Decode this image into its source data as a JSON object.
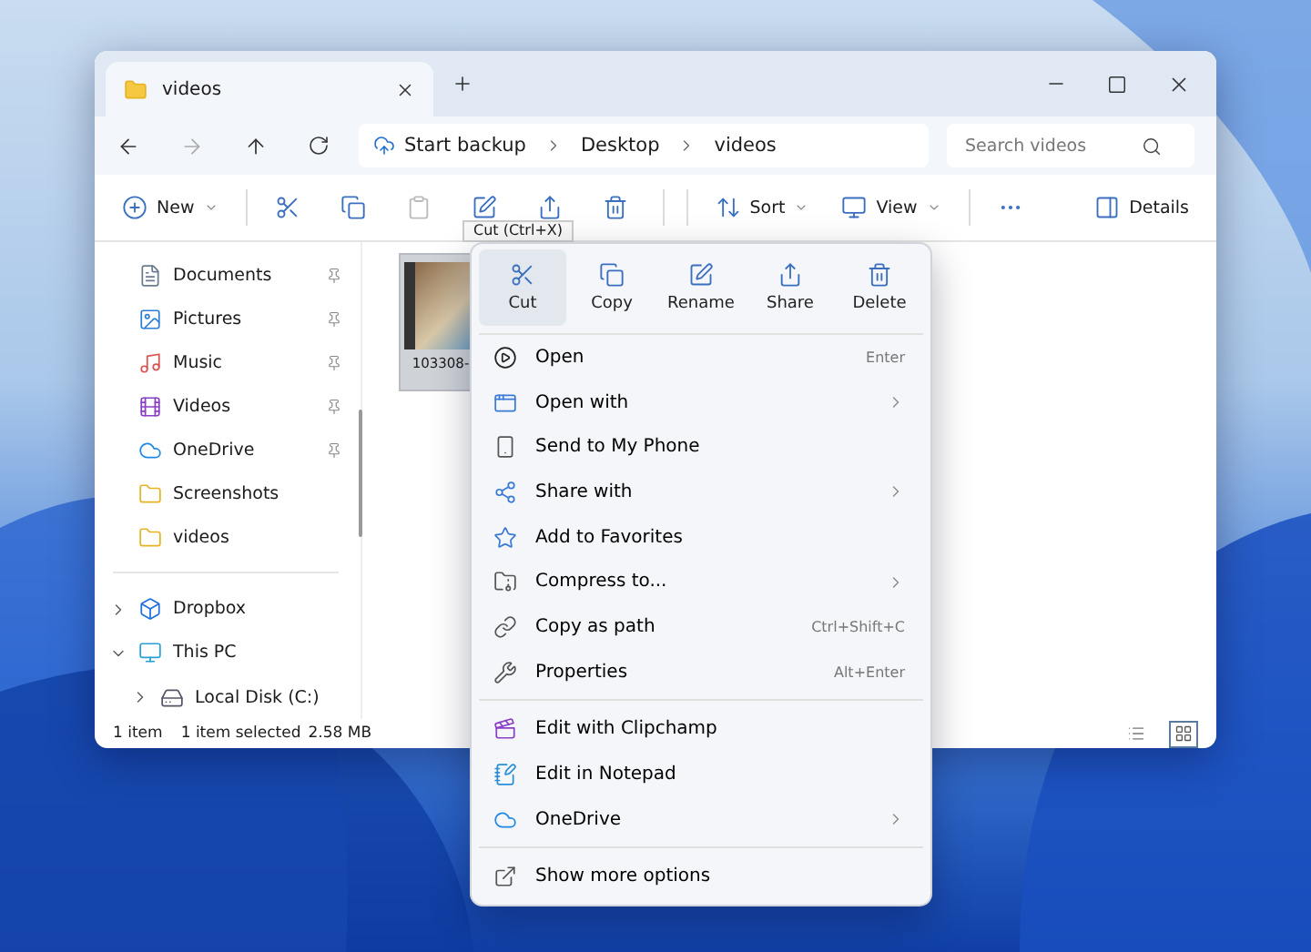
{
  "window": {
    "tab": {
      "title": "videos",
      "selected": true
    }
  },
  "address": {
    "crumbs": [
      {
        "kind": "backup",
        "label": "Start backup"
      },
      {
        "kind": "folder",
        "label": "Desktop"
      },
      {
        "kind": "folder",
        "label": "videos"
      }
    ],
    "search_placeholder": "Search videos"
  },
  "toolbar": {
    "buttons": [
      {
        "kind": "new",
        "label": "New",
        "disabled": false
      },
      {
        "kind": "cut",
        "disabled": false
      },
      {
        "kind": "copy",
        "disabled": false
      },
      {
        "kind": "paste",
        "disabled": true
      },
      {
        "kind": "rename",
        "disabled": false
      },
      {
        "kind": "share",
        "disabled": false
      },
      {
        "kind": "delete",
        "disabled": false
      },
      {
        "kind": "sort",
        "label": "Sort",
        "disabled": false
      },
      {
        "kind": "view",
        "label": "View",
        "disabled": false
      },
      {
        "kind": "more",
        "disabled": false
      }
    ],
    "details": "Details",
    "tooltip": "Cut (Ctrl+X)"
  },
  "sidebar": {
    "quick_access": [
      {
        "kind": "documents",
        "label": "Documents",
        "pinned": true
      },
      {
        "kind": "pictures",
        "label": "Pictures",
        "pinned": true
      },
      {
        "kind": "music",
        "label": "Music",
        "pinned": true
      },
      {
        "kind": "videos",
        "label": "Videos",
        "pinned": true
      },
      {
        "kind": "onedrive",
        "label": "OneDrive",
        "pinned": true
      },
      {
        "kind": "folder",
        "label": "Screenshots",
        "pinned": false
      },
      {
        "kind": "folder",
        "label": "videos",
        "pinned": false
      }
    ],
    "tree": [
      {
        "kind": "dropbox",
        "label": "Dropbox",
        "expanded": false
      },
      {
        "kind": "pc",
        "label": "This PC",
        "expanded": true,
        "children": [
          {
            "kind": "disk",
            "label": "Local Disk (C:)",
            "expanded": false
          }
        ]
      }
    ]
  },
  "files": [
    {
      "name": "103308-",
      "selected": true
    }
  ],
  "status_bar": {
    "count": "1 item",
    "selection": "1 item selected",
    "size": "2.58 MB",
    "views": [
      {
        "kind": "details",
        "selected": false
      },
      {
        "kind": "tiles",
        "selected": true
      }
    ]
  },
  "context_menu": {
    "actions": [
      {
        "kind": "cut",
        "label": "Cut",
        "selected": true
      },
      {
        "kind": "copy",
        "label": "Copy",
        "selected": false
      },
      {
        "kind": "rename",
        "label": "Rename",
        "selected": false
      },
      {
        "kind": "share",
        "label": "Share",
        "selected": false
      },
      {
        "kind": "delete",
        "label": "Delete",
        "selected": false
      }
    ],
    "groups": [
      [
        {
          "kind": "open",
          "label": "Open",
          "shortcut": "Enter",
          "submenu": false
        },
        {
          "kind": "openwith",
          "label": "Open with",
          "submenu": true
        },
        {
          "kind": "phone",
          "label": "Send to My Phone",
          "submenu": false
        },
        {
          "kind": "sharewith",
          "label": "Share with",
          "submenu": true
        },
        {
          "kind": "star",
          "label": "Add to Favorites",
          "submenu": false
        },
        {
          "kind": "compress",
          "label": "Compress to...",
          "submenu": true
        },
        {
          "kind": "path",
          "label": "Copy as path",
          "shortcut": "Ctrl+Shift+C",
          "submenu": false
        },
        {
          "kind": "properties",
          "label": "Properties",
          "shortcut": "Alt+Enter",
          "submenu": false
        }
      ],
      [
        {
          "kind": "clipchamp",
          "label": "Edit with Clipchamp",
          "submenu": false
        },
        {
          "kind": "notepad",
          "label": "Edit in Notepad",
          "submenu": false
        },
        {
          "kind": "onedrive",
          "label": "OneDrive",
          "submenu": true
        }
      ],
      [
        {
          "kind": "more",
          "label": "Show more options",
          "submenu": false
        }
      ]
    ]
  }
}
